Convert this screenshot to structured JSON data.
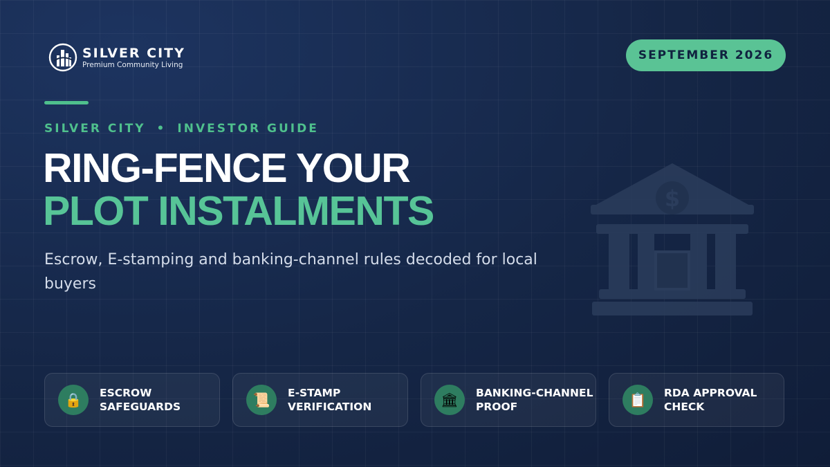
{
  "brand": {
    "name": "SILVER CITY",
    "tagline": "Premium Community Living"
  },
  "date_badge": "SEPTEMBER 2026",
  "kicker": {
    "left": "SILVER CITY",
    "separator": "•",
    "right": "INVESTOR GUIDE"
  },
  "headline": {
    "line1": "RING-FENCE YOUR",
    "line2": "PLOT INSTALMENTS"
  },
  "subheadline": "Escrow, E-stamping and banking-channel rules decoded for local buyers",
  "features": [
    {
      "icon": "🔒",
      "icon_name": "lock-icon",
      "label": "ESCROW SAFEGUARDS"
    },
    {
      "icon": "📜",
      "icon_name": "scroll-icon",
      "label": "E-STAMP VERIFICATION"
    },
    {
      "icon": "🏛",
      "icon_name": "bank-icon",
      "label": "BANKING-CHANNEL PROOF"
    },
    {
      "icon": "📋",
      "icon_name": "clipboard-icon",
      "label": "RDA APPROVAL CHECK"
    }
  ],
  "colors": {
    "background": "#152646",
    "accent_green": "#57c497",
    "pill_green": "#5ac395",
    "icon_circle": "#2e7d60",
    "text_white": "#ffffff"
  }
}
